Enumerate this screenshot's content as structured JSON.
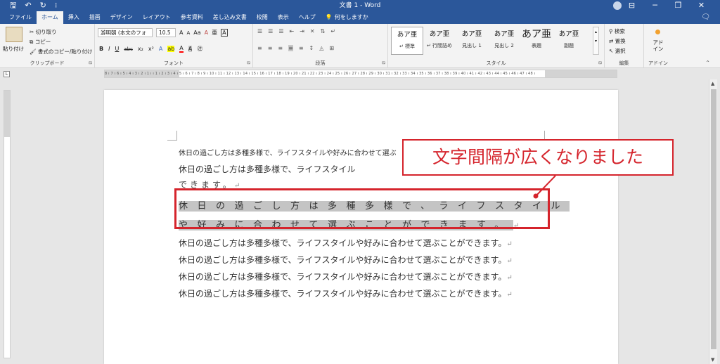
{
  "titlebar": {
    "title": "文書 1  -  Word",
    "qat": [
      "🖫",
      "↶",
      "↻",
      "⁝"
    ],
    "controls": [
      "⊟",
      "─",
      "❐",
      "✕"
    ]
  },
  "tabs": [
    {
      "label": "ファイル",
      "active": false
    },
    {
      "label": "ホーム",
      "active": true
    },
    {
      "label": "挿入",
      "active": false
    },
    {
      "label": "描画",
      "active": false
    },
    {
      "label": "デザイン",
      "active": false
    },
    {
      "label": "レイアウト",
      "active": false
    },
    {
      "label": "参考資料",
      "active": false
    },
    {
      "label": "差し込み文書",
      "active": false
    },
    {
      "label": "校閲",
      "active": false
    },
    {
      "label": "表示",
      "active": false
    },
    {
      "label": "ヘルプ",
      "active": false
    }
  ],
  "tellme": "何をしますか",
  "ribbon": {
    "clipboard": {
      "paste": "貼り付け",
      "cut": "切り取り",
      "copy": "コピー",
      "format_painter": "書式のコピー/貼り付け",
      "label": "クリップボード"
    },
    "font": {
      "font_name": "游明朝 (本文のフォン",
      "font_size": "10.5",
      "buttons_row1": [
        "A",
        "A",
        "Aa",
        "A",
        "亜",
        "A"
      ],
      "buttons_row2": [
        "B",
        "I",
        "U",
        "abc",
        "x₂",
        "x²",
        "A",
        "ab",
        "A",
        "A",
        "㊟"
      ],
      "label": "フォント"
    },
    "paragraph": {
      "label": "段落"
    },
    "styles": {
      "items": [
        {
          "sample": "あア亜",
          "name": "↵ 標準",
          "selected": true,
          "big": false
        },
        {
          "sample": "あア亜",
          "name": "↵ 行間詰め",
          "selected": false,
          "big": false
        },
        {
          "sample": "あア亜",
          "name": "見出し 1",
          "selected": false,
          "big": false
        },
        {
          "sample": "あア亜",
          "name": "見出し 2",
          "selected": false,
          "big": false
        },
        {
          "sample": "あア亜",
          "name": "表題",
          "selected": false,
          "big": true
        },
        {
          "sample": "あア亜",
          "name": "副題",
          "selected": false,
          "big": false
        }
      ],
      "label": "スタイル"
    },
    "editing": {
      "find": "検索",
      "replace": "置換",
      "select": "選択",
      "label": "編集"
    },
    "addin": {
      "name": "アド\nイン",
      "label": "アドイン"
    }
  },
  "ruler": {
    "corner": "L",
    "numbers": "8 ı 7 ı 6 ı 5 ı 4 ı 3 ı 2 ı 1 ı   ı 1 ı 2 ı 3 ı 4 ı 5 ı 6 ı 7 ı 8 ı 9 ı 10 ı 11 ı 12 ı 13 ı 14 ı 15 ı 16 ı 17 ı 18 ı 19 ı 20 ı 21 ı 22 ı 23 ı 24 ı 25 ı 26 ı 27 ı 28 ı 29 ı 30 ı 31 ı 32 ı 33 ı 34 ı 35 ı 36 ı 37 ı 38 ı 39 ı 40 ı 41 ı 42 ı 43 ı 44 ı 45 ı 46 ı 47 ı 48 ı"
  },
  "document": {
    "line1": "休日の過ごし方は多種多様で、ライフスタイルや好みに合わせて選ぶ",
    "line2": "休日の過ごし方は多種多様で、ライフスタイル",
    "line3": "できます。",
    "spaced_line1": "休日の過ごし方は多種多様で、ライフスタイル",
    "spaced_line2": "や好みに合わせて選ぶことができます。",
    "normal_lines": [
      "休日の過ごし方は多種多様で、ライフスタイルや好みに合わせて選ぶことができます。",
      "休日の過ごし方は多種多様で、ライフスタイルや好みに合わせて選ぶことができます。",
      "休日の過ごし方は多種多様で、ライフスタイルや好みに合わせて選ぶことができます。",
      "休日の過ごし方は多種多様で、ライフスタイルや好みに合わせて選ぶことができます。"
    ],
    "para_mark": "↵"
  },
  "annotation": {
    "callout_text": "文字間隔が広くなりました",
    "color": "#d5242c"
  },
  "colors": {
    "word_blue": "#2b579a",
    "ribbon_bg": "#f3f3f3",
    "selection": "#c4c4c4"
  }
}
